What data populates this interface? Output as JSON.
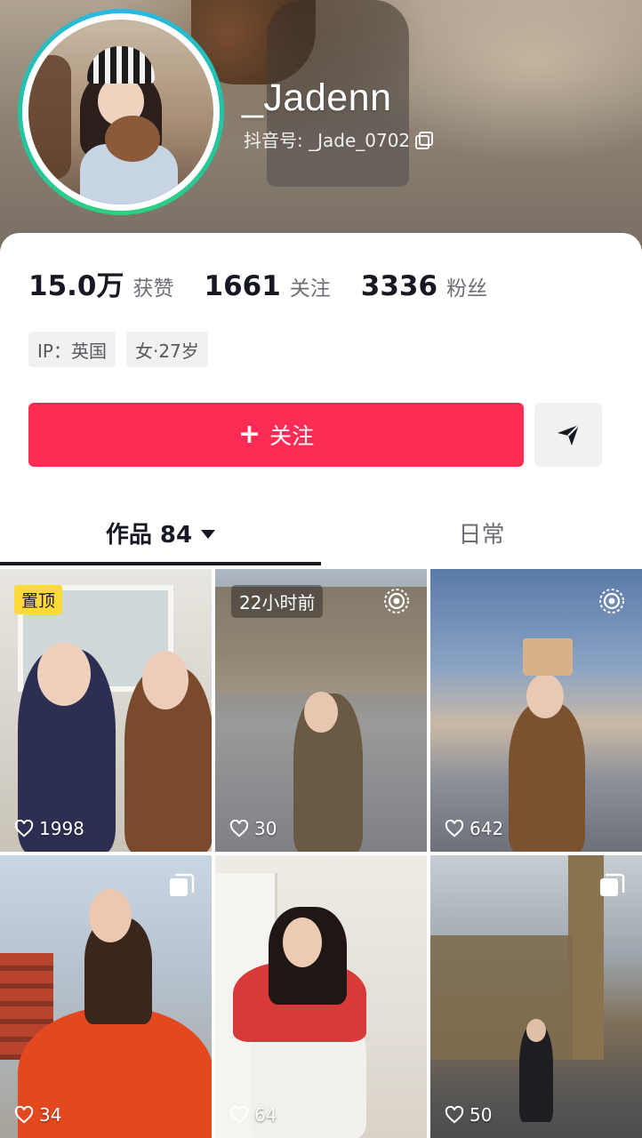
{
  "profile": {
    "username": "_Jadenn",
    "douyin_id": "抖音号: _Jade_0702"
  },
  "stats": [
    {
      "value": "15.0万",
      "label": "获赞"
    },
    {
      "value": "1661",
      "label": "关注"
    },
    {
      "value": "3336",
      "label": "粉丝"
    }
  ],
  "tags": [
    "IP：英国",
    "女·27岁"
  ],
  "actions": {
    "follow_label": "关注",
    "plus": "+"
  },
  "tabs": {
    "works_label": "作品 84",
    "daily_label": "日常"
  },
  "posts": [
    {
      "likes": "1998",
      "badge": "置顶"
    },
    {
      "likes": "30",
      "badge": "22小时前"
    },
    {
      "likes": "642"
    },
    {
      "likes": "34"
    },
    {
      "likes": "64"
    },
    {
      "likes": "50"
    }
  ],
  "colors": {
    "accent": "#fe2c55",
    "avatar_ring": "#20c4a3",
    "pin_badge": "#ffd83a"
  }
}
